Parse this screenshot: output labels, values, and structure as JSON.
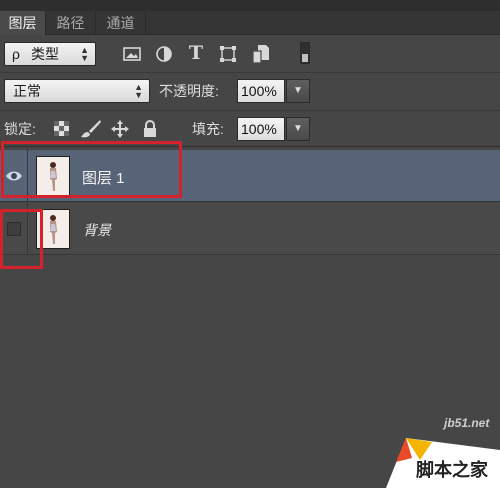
{
  "tabs": [
    {
      "label": "图层",
      "active": true
    },
    {
      "label": "路径",
      "active": false
    },
    {
      "label": "通道",
      "active": false
    }
  ],
  "filter": {
    "search_glyph": "ρ",
    "kind_label": "类型"
  },
  "filter_icons": [
    "image-filter-icon",
    "adjustment-filter-icon",
    "type-filter-icon",
    "shape-filter-icon",
    "smart-object-filter-icon",
    "filter-toggle-icon"
  ],
  "blend_mode": "正常",
  "opacity": {
    "label": "不透明度:",
    "value": "100%"
  },
  "lock": {
    "label": "锁定:"
  },
  "fill": {
    "label": "填充:",
    "value": "100%"
  },
  "layers": [
    {
      "name": "图层 1",
      "visible": true,
      "selected": true
    },
    {
      "name": "背景",
      "visible": false,
      "selected": false
    }
  ],
  "watermark": {
    "site": "jb51.net",
    "brand": "脚本之家"
  },
  "colors": {
    "highlight": "#d3222b",
    "selected_row": "#576477",
    "panel_bg": "#464646"
  }
}
